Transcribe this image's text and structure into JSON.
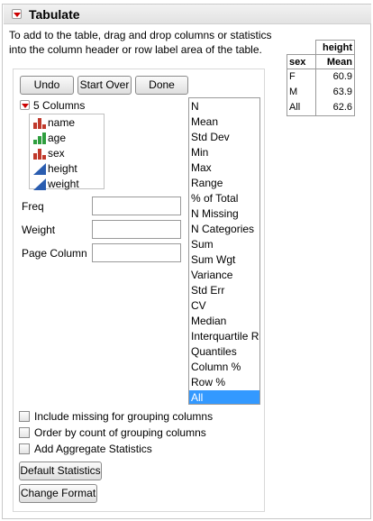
{
  "window": {
    "title": "Tabulate"
  },
  "instructions": {
    "line1": "To add to the table, drag and drop columns or statistics",
    "line2": "into the column header or row label area of the table."
  },
  "toolbar": {
    "undo_label": "Undo",
    "start_over_label": "Start Over",
    "done_label": "Done"
  },
  "columns": {
    "header": "5 Columns",
    "items": [
      {
        "name": "name",
        "icon": "nominal-icon"
      },
      {
        "name": "age",
        "icon": "ordinal-icon"
      },
      {
        "name": "sex",
        "icon": "nominal-icon"
      },
      {
        "name": "height",
        "icon": "continuous-icon"
      },
      {
        "name": "weight",
        "icon": "continuous-icon"
      }
    ]
  },
  "roles": {
    "freq": "Freq",
    "weight": "Weight",
    "page_column": "Page Column"
  },
  "statistics": {
    "items": [
      "N",
      "Mean",
      "Std Dev",
      "Min",
      "Max",
      "Range",
      "% of Total",
      "N Missing",
      "N Categories",
      "Sum",
      "Sum Wgt",
      "Variance",
      "Std Err",
      "CV",
      "Median",
      "Interquartile Ra",
      "Quantiles",
      "Column %",
      "Row %",
      "All"
    ],
    "selected": "All"
  },
  "options": {
    "include_missing": "Include missing for grouping columns",
    "order_by_count": "Order by count of grouping columns",
    "add_aggregate": "Add Aggregate Statistics"
  },
  "bottom_buttons": {
    "default_statistics": "Default Statistics",
    "change_format": "Change Format"
  },
  "result_table": {
    "column_header": "height",
    "row_header": "sex",
    "stat_header": "Mean",
    "rows": [
      {
        "label": "F",
        "value": "60.9"
      },
      {
        "label": "M",
        "value": "63.9"
      },
      {
        "label": "All",
        "value": "62.6"
      }
    ]
  },
  "colors": {
    "disclosure_arrow": "#cc0000",
    "selection": "#3399ff",
    "nominal": "#c0392b",
    "ordinal": "#2e9e3e",
    "continuous": "#2a5db0"
  }
}
